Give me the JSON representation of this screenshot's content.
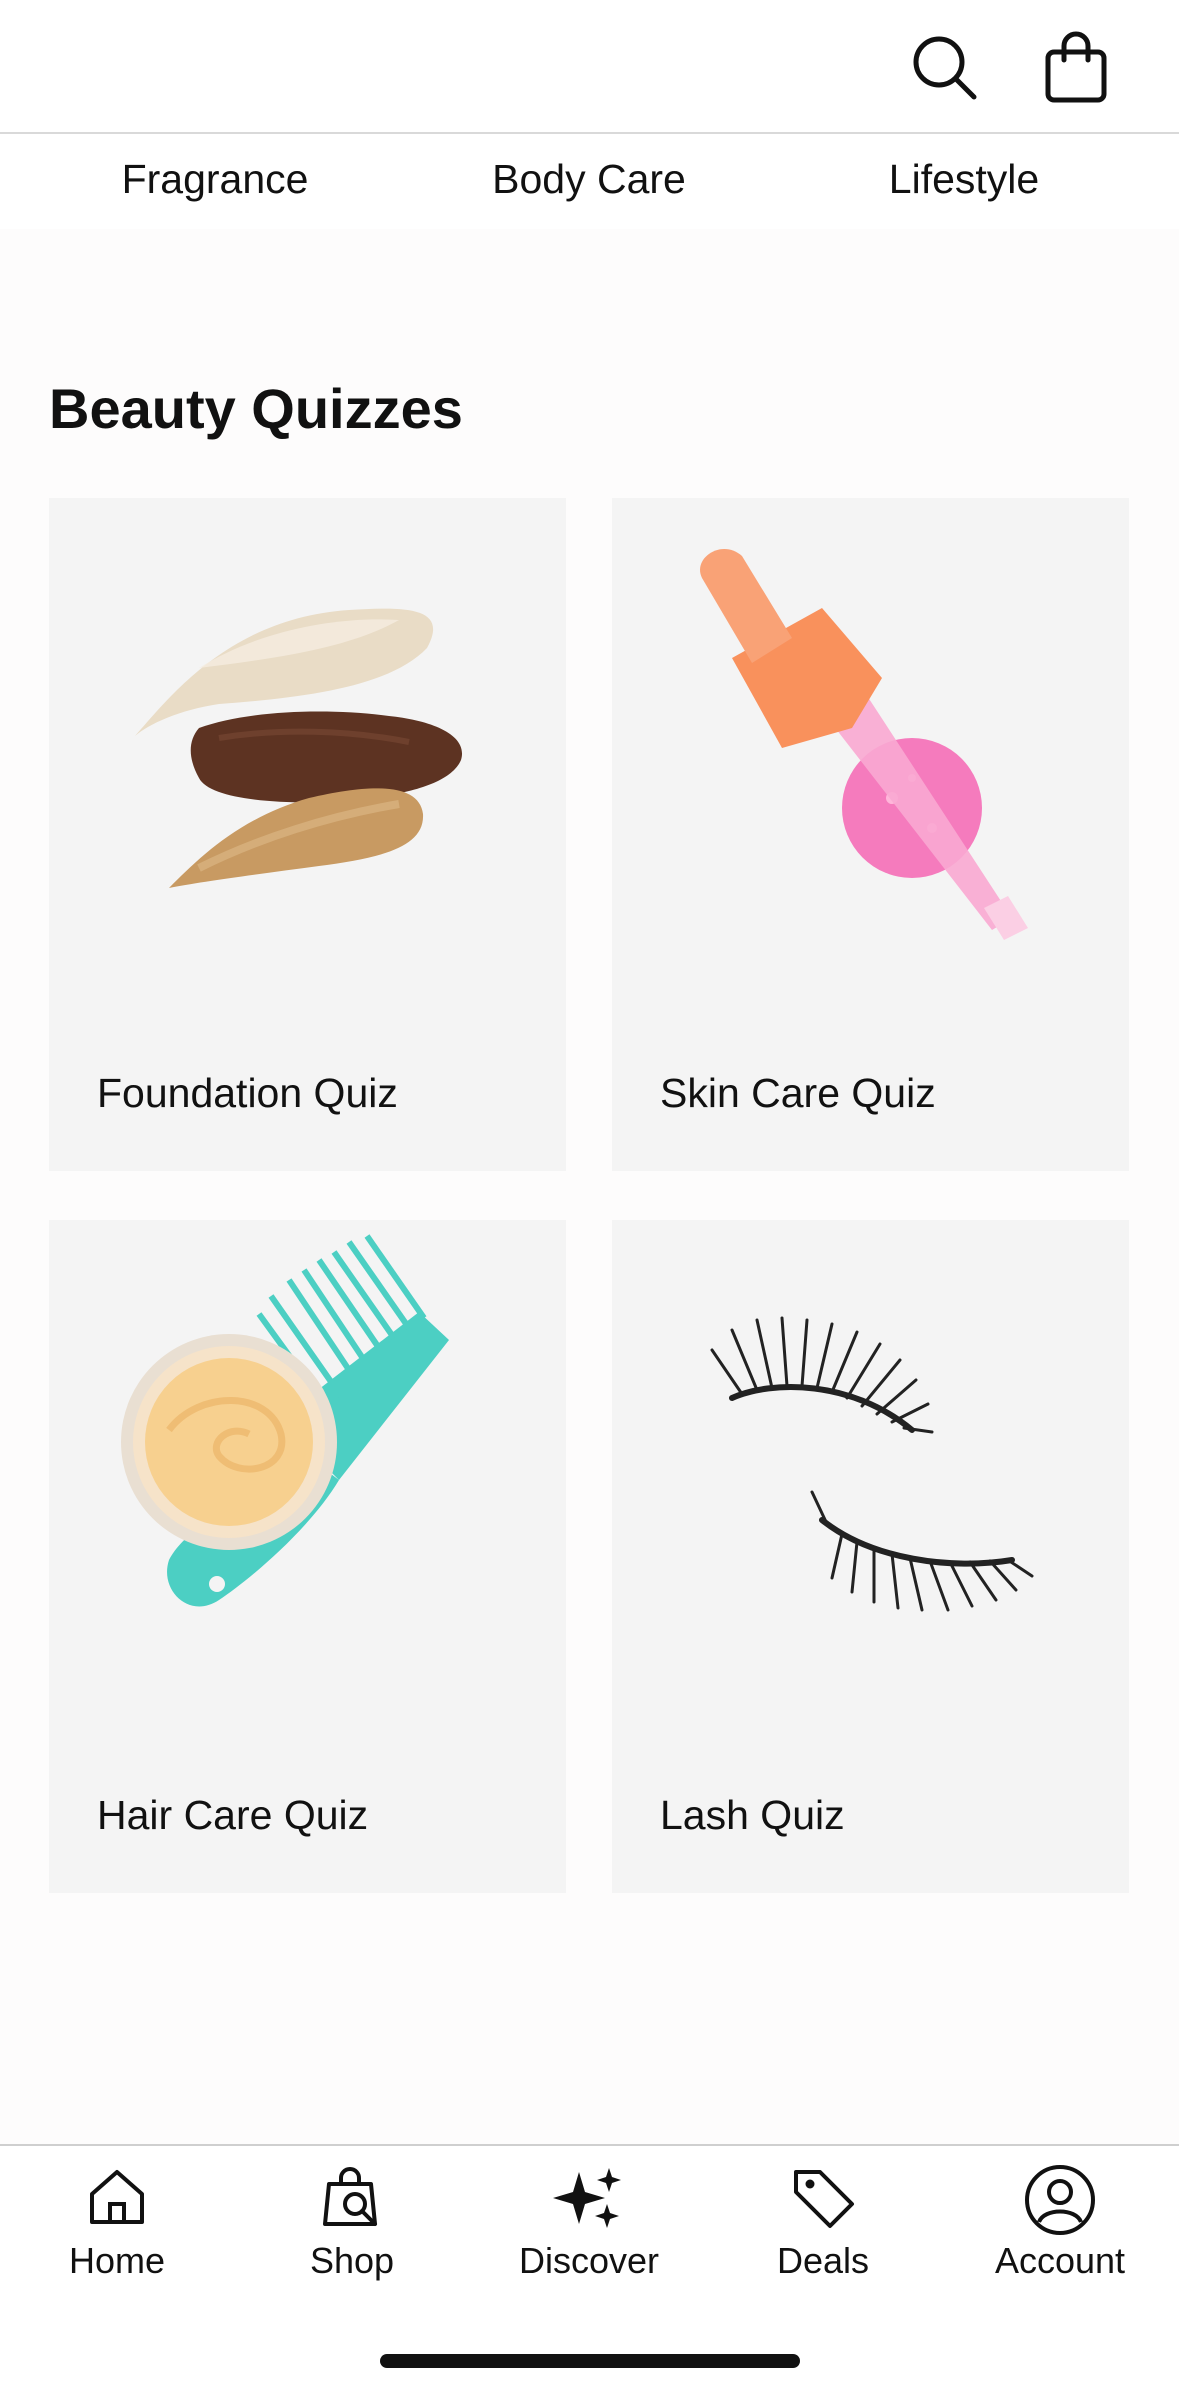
{
  "categories": [
    "Fragrance",
    "Body Care",
    "Lifestyle"
  ],
  "section": {
    "title": "Beauty Quizzes"
  },
  "quizzes": [
    {
      "label": "Foundation Quiz",
      "image": "foundation-swatches"
    },
    {
      "label": "Skin Care Quiz",
      "image": "serum-dropper"
    },
    {
      "label": "Hair Care Quiz",
      "image": "hair-cream-and-comb"
    },
    {
      "label": "Lash Quiz",
      "image": "false-lashes"
    }
  ],
  "tabbar": {
    "items": [
      {
        "label": "Home",
        "icon": "home-icon"
      },
      {
        "label": "Shop",
        "icon": "shop-bag-icon"
      },
      {
        "label": "Discover",
        "icon": "sparkle-icon"
      },
      {
        "label": "Deals",
        "icon": "tag-icon"
      },
      {
        "label": "Account",
        "icon": "account-icon"
      }
    ]
  },
  "header": {
    "icons": [
      "search-icon",
      "shopping-bag-icon"
    ]
  },
  "colors": {
    "card_bg": "#f4f4f4",
    "text": "#111111",
    "divider": "#d9d9d9"
  }
}
